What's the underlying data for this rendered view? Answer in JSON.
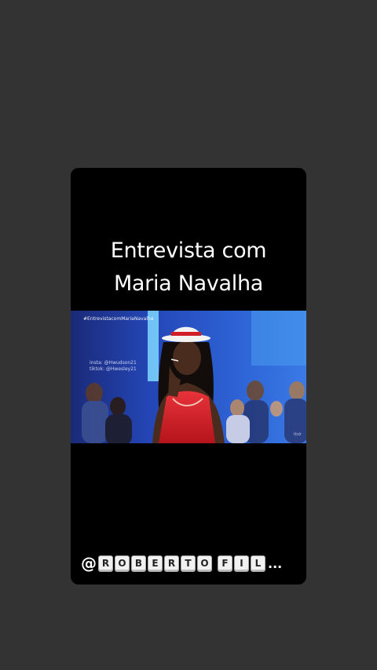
{
  "story": {
    "title_line_1": "Entrevista com",
    "title_line_2": "Maria Navalha",
    "video": {
      "hashtag": "#EntrevistacomMariaNavalha",
      "credit_line_1": "insta: @Hwudson21",
      "credit_line_2": "tiktok: @Hwesley21",
      "watermark": "tbdr"
    },
    "handle": {
      "at": "@",
      "letters_word_1": [
        "R",
        "O",
        "B",
        "E",
        "R",
        "T",
        "O"
      ],
      "letters_word_2": [
        "F",
        "I",
        "L"
      ],
      "ellipsis": "..."
    }
  },
  "colors": {
    "page_background": "#333333",
    "card_background": "#000000",
    "stage_blue": "#1c3c9c",
    "dress_red": "#d9222a",
    "hat_white": "#f2f2f2"
  }
}
